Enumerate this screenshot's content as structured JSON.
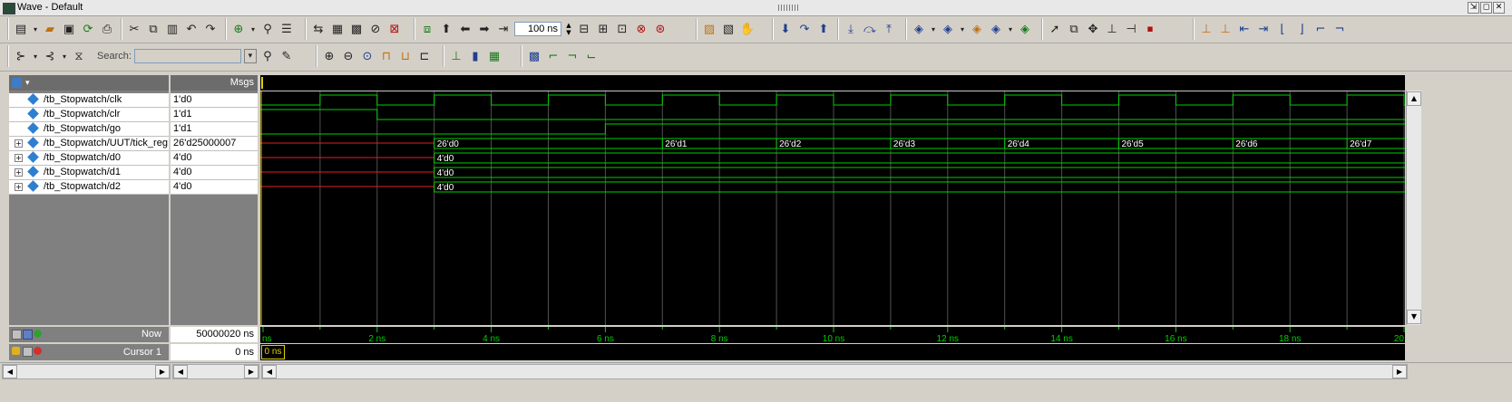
{
  "window": {
    "title": "Wave - Default"
  },
  "toolbar": {
    "time_step_value": "100 ns",
    "search_label": "Search:",
    "search_value": ""
  },
  "panes": {
    "msgs_header": "Msgs"
  },
  "signals": [
    {
      "name": "/tb_Stopwatch/clk",
      "value": "1'd0",
      "expandable": false
    },
    {
      "name": "/tb_Stopwatch/clr",
      "value": "1'd1",
      "expandable": false
    },
    {
      "name": "/tb_Stopwatch/go",
      "value": "1'd1",
      "expandable": false
    },
    {
      "name": "/tb_Stopwatch/UUT/tick_reg",
      "value": "26'd25000007",
      "expandable": true
    },
    {
      "name": "/tb_Stopwatch/d0",
      "value": "4'd0",
      "expandable": true
    },
    {
      "name": "/tb_Stopwatch/d1",
      "value": "4'd0",
      "expandable": true
    },
    {
      "name": "/tb_Stopwatch/d2",
      "value": "4'd0",
      "expandable": true
    }
  ],
  "waves": {
    "time_range_ns": [
      0,
      20
    ],
    "clk_edges_ns": [
      1,
      2,
      3,
      4,
      5,
      6,
      7,
      8,
      9,
      10,
      11,
      12,
      13,
      14,
      15,
      16,
      17,
      18,
      19,
      20
    ],
    "clk_initial": 0,
    "clr_fall_ns": 2,
    "go_fall_ns": 6,
    "bus_unknown_until_ns": 3,
    "tick_reg_changes": [
      {
        "t": 3,
        "label": "26'd0"
      },
      {
        "t": 7,
        "label": "26'd1"
      },
      {
        "t": 9,
        "label": "26'd2"
      },
      {
        "t": 11,
        "label": "26'd3"
      },
      {
        "t": 13,
        "label": "26'd4"
      },
      {
        "t": 15,
        "label": "26'd5"
      },
      {
        "t": 17,
        "label": "26'd6"
      },
      {
        "t": 19,
        "label": "26'd7"
      }
    ],
    "digit_label": "4'd0",
    "colors": {
      "wave": "#00d000",
      "unknown": "#e02020",
      "grid": "#505050",
      "cursor": "#e8d000"
    }
  },
  "footer": {
    "now_label": "Now",
    "now_value": "50000020 ns",
    "cursor_label": "Cursor 1",
    "cursor_value": "0 ns",
    "cursor_flag": "0 ns",
    "timeline_ticks": [
      "ns",
      "2 ns",
      "4 ns",
      "6 ns",
      "8 ns",
      "10 ns",
      "12 ns",
      "14 ns",
      "16 ns",
      "18 ns",
      "20"
    ]
  }
}
